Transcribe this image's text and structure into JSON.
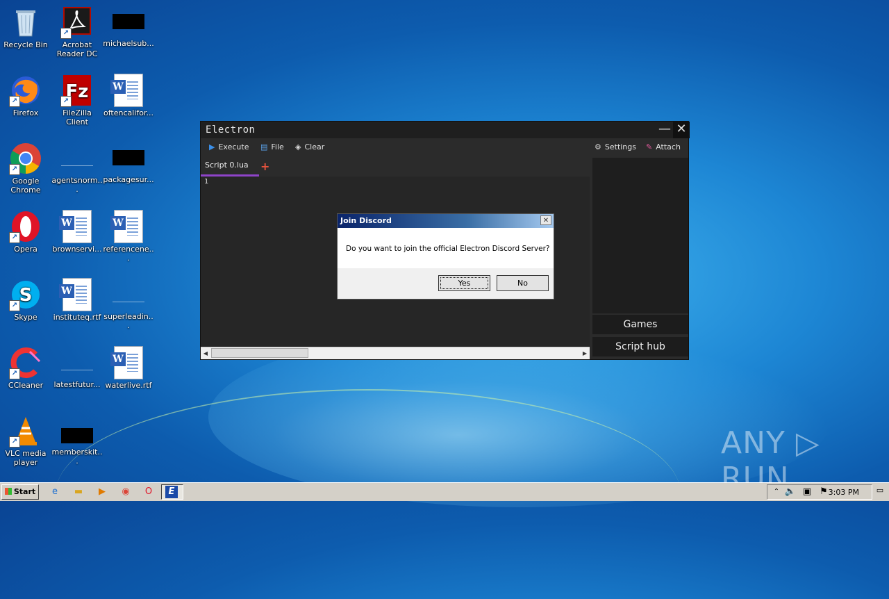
{
  "desktop": {
    "icons": [
      {
        "label": "Recycle Bin",
        "icon": "recycle-bin-icon"
      },
      {
        "label": "Acrobat Reader DC",
        "icon": "acrobat-icon"
      },
      {
        "label": "michaelsub...",
        "icon": "file-icon"
      },
      {
        "label": "Firefox",
        "icon": "firefox-icon"
      },
      {
        "label": "FileZilla Client",
        "icon": "filezilla-icon"
      },
      {
        "label": "oftencalifor...",
        "icon": "word-doc-icon"
      },
      {
        "label": "Google Chrome",
        "icon": "chrome-icon"
      },
      {
        "label": "agentsnorm...",
        "icon": "file-icon"
      },
      {
        "label": "packagesur...",
        "icon": "file-icon"
      },
      {
        "label": "Opera",
        "icon": "opera-icon"
      },
      {
        "label": "brownservi...",
        "icon": "word-doc-icon"
      },
      {
        "label": "referencene...",
        "icon": "word-doc-icon"
      },
      {
        "label": "Skype",
        "icon": "skype-icon"
      },
      {
        "label": "instituteq.rtf",
        "icon": "word-doc-icon"
      },
      {
        "label": "superleadin...",
        "icon": "file-icon"
      },
      {
        "label": "CCleaner",
        "icon": "ccleaner-icon"
      },
      {
        "label": "latestfutur...",
        "icon": "file-icon"
      },
      {
        "label": "waterlive.rtf",
        "icon": "word-doc-icon"
      },
      {
        "label": "VLC media player",
        "icon": "vlc-icon"
      },
      {
        "label": "memberskit...",
        "icon": "file-icon"
      }
    ]
  },
  "electron": {
    "title": "Electron",
    "toolbar": {
      "execute": "Execute",
      "file": "File",
      "clear": "Clear",
      "settings": "Settings",
      "attach": "Attach"
    },
    "tab": "Script 0.lua",
    "add_tab": "+",
    "line_number": "1",
    "side_buttons": {
      "games": "Games",
      "script_hub": "Script hub"
    }
  },
  "dialog": {
    "title": "Join Discord",
    "message": "Do you want to join the official Electron Discord Server?",
    "yes": "Yes",
    "no": "No",
    "close": "✕"
  },
  "watermark": "ANY ▷ RUN",
  "taskbar": {
    "start": "Start",
    "clock": "3:03 PM"
  },
  "colors": {
    "tab_underline": "#8e44c9",
    "execute_icon": "#3b8fe8",
    "dialog_title": "#0a246a"
  }
}
